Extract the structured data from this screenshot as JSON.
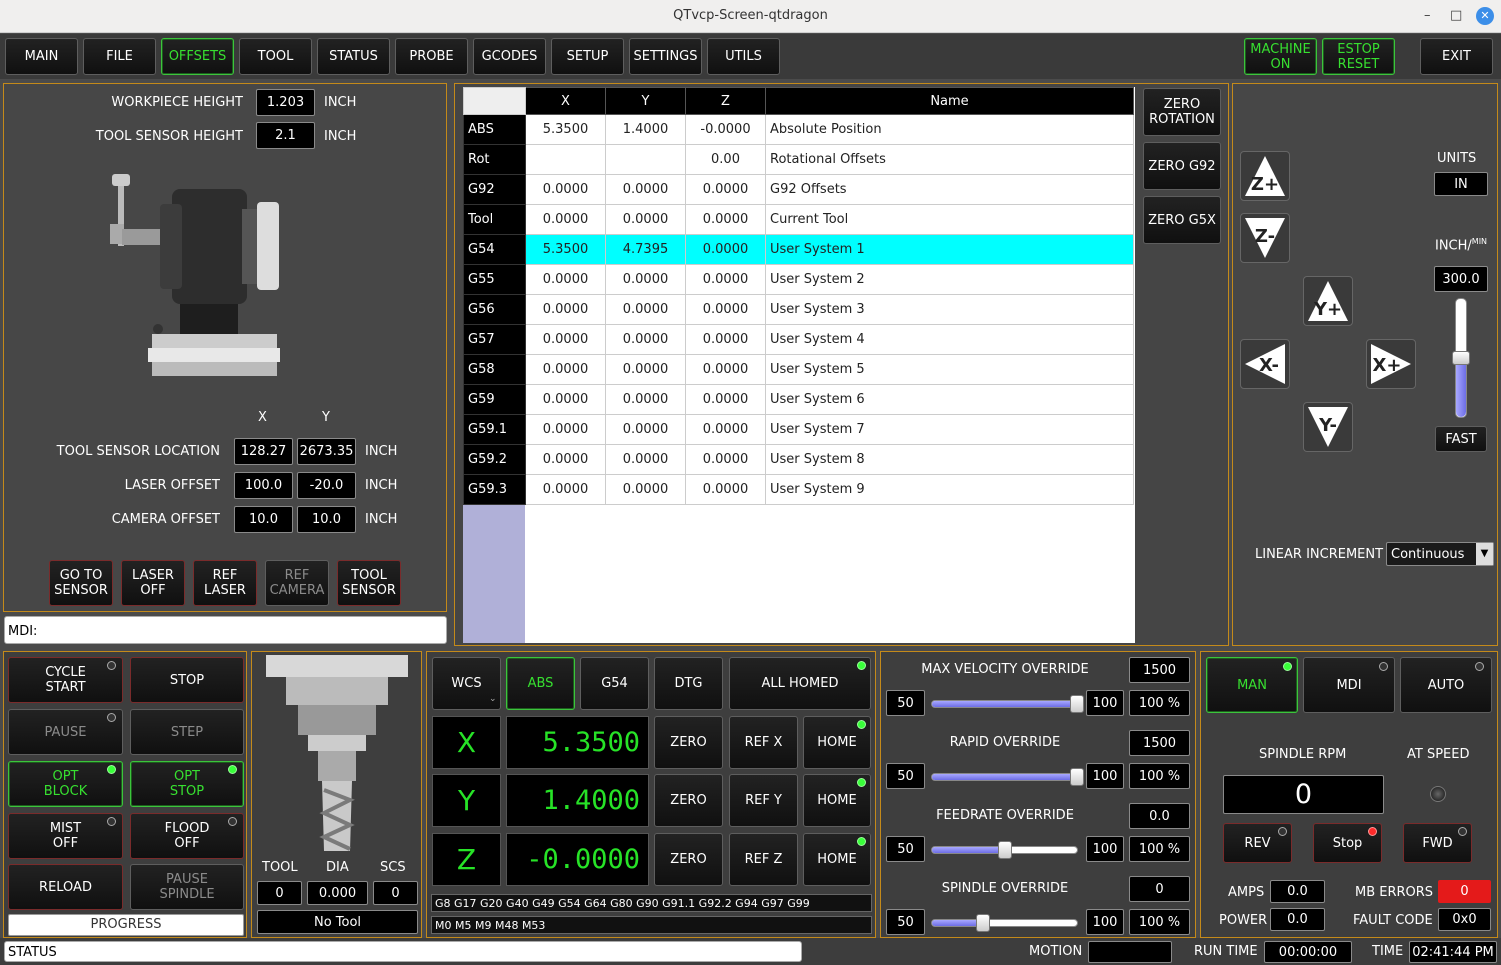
{
  "window": {
    "title": "QTvcp-Screen-qtdragon",
    "minimize": "–",
    "maximize": "□",
    "close": "✕"
  },
  "tabs": [
    {
      "label": "MAIN"
    },
    {
      "label": "FILE"
    },
    {
      "label": "OFFSETS"
    },
    {
      "label": "TOOL"
    },
    {
      "label": "STATUS"
    },
    {
      "label": "PROBE"
    },
    {
      "label": "GCODES"
    },
    {
      "label": "SETUP"
    },
    {
      "label": "SETTINGS"
    },
    {
      "label": "UTILS"
    }
  ],
  "machine": {
    "machine_on": "MACHINE\nON",
    "estop_reset": "ESTOP\nRESET",
    "exit": "EXIT"
  },
  "left": {
    "workpiece_height_label": "WORKPIECE HEIGHT",
    "workpiece_height": "1.203",
    "tool_sensor_height_label": "TOOL SENSOR HEIGHT",
    "tool_sensor_height": "2.1",
    "unit": "INCH",
    "col_x": "X",
    "col_y": "Y",
    "tool_sensor_location_label": "TOOL SENSOR LOCATION",
    "tsl_x": "128.27",
    "tsl_y": "2673.35",
    "laser_offset_label": "LASER OFFSET",
    "lo_x": "100.0",
    "lo_y": "-20.0",
    "camera_offset_label": "CAMERA OFFSET",
    "co_x": "10.0",
    "co_y": "10.0",
    "buttons": [
      {
        "label": "GO TO\nSENSOR"
      },
      {
        "label": "LASER\nOFF"
      },
      {
        "label": "REF\nLASER"
      },
      {
        "label": "REF\nCAMERA"
      },
      {
        "label": "TOOL\nSENSOR"
      }
    ]
  },
  "mdi": {
    "label": "MDI:"
  },
  "offsets_table": {
    "headers": [
      "",
      "X",
      "Y",
      "Z",
      "Name"
    ],
    "rows": [
      {
        "id": "ABS",
        "x": "5.3500",
        "y": "1.4000",
        "z": "-0.0000",
        "name": "Absolute Position"
      },
      {
        "id": "Rot",
        "x": "",
        "y": "",
        "z": "0.00",
        "name": "Rotational Offsets"
      },
      {
        "id": "G92",
        "x": "0.0000",
        "y": "0.0000",
        "z": "0.0000",
        "name": "G92 Offsets"
      },
      {
        "id": "Tool",
        "x": "0.0000",
        "y": "0.0000",
        "z": "0.0000",
        "name": "Current Tool"
      },
      {
        "id": "G54",
        "x": "5.3500",
        "y": "4.7395",
        "z": "0.0000",
        "name": "User System 1"
      },
      {
        "id": "G55",
        "x": "0.0000",
        "y": "0.0000",
        "z": "0.0000",
        "name": "User System 2"
      },
      {
        "id": "G56",
        "x": "0.0000",
        "y": "0.0000",
        "z": "0.0000",
        "name": "User System 3"
      },
      {
        "id": "G57",
        "x": "0.0000",
        "y": "0.0000",
        "z": "0.0000",
        "name": "User System 4"
      },
      {
        "id": "G58",
        "x": "0.0000",
        "y": "0.0000",
        "z": "0.0000",
        "name": "User System 5"
      },
      {
        "id": "G59",
        "x": "0.0000",
        "y": "0.0000",
        "z": "0.0000",
        "name": "User System 6"
      },
      {
        "id": "G59.1",
        "x": "0.0000",
        "y": "0.0000",
        "z": "0.0000",
        "name": "User System 7"
      },
      {
        "id": "G59.2",
        "x": "0.0000",
        "y": "0.0000",
        "z": "0.0000",
        "name": "User System 8"
      },
      {
        "id": "G59.3",
        "x": "0.0000",
        "y": "0.0000",
        "z": "0.0000",
        "name": "User System 9"
      }
    ],
    "zero_rotation": "ZERO\nROTATION",
    "zero_g92": "ZERO G92",
    "zero_g5x": "ZERO G5X"
  },
  "jog": {
    "units_label": "UNITS",
    "units": "IN",
    "rate_label": "INCH/",
    "rate_sup": "MIN",
    "rate": "300.0",
    "fast": "FAST",
    "linear_increment_label": "LINEAR INCREMENT",
    "linear_increment": "Continuous",
    "zplus": "Z+",
    "zminus": "Z-",
    "yplus": "Y+",
    "yminus": "Y-",
    "xplus": "X+",
    "xminus": "X-"
  },
  "cycle": {
    "cycle_start": "CYCLE\nSTART",
    "stop": "STOP",
    "pause": "PAUSE",
    "step": "STEP",
    "opt_block": "OPT\nBLOCK",
    "opt_stop": "OPT\nSTOP",
    "mist_off": "MIST\nOFF",
    "flood_off": "FLOOD\nOFF",
    "reload": "RELOAD",
    "pause_spindle": "PAUSE\nSPINDLE",
    "progress": "PROGRESS"
  },
  "tool": {
    "tool_label": "TOOL",
    "dia_label": "DIA",
    "scs_label": "SCS",
    "tool": "0",
    "dia": "0.000",
    "scs": "0",
    "name": "No Tool"
  },
  "dro": {
    "wcs": "WCS",
    "abs": "ABS",
    "g54": "G54",
    "dtg": "DTG",
    "all_homed": "ALL HOMED",
    "axes": [
      {
        "axis": "X",
        "value": "5.3500",
        "ref": "REF X"
      },
      {
        "axis": "Y",
        "value": "1.4000",
        "ref": "REF Y"
      },
      {
        "axis": "Z",
        "value": "-0.0000",
        "ref": "REF Z"
      }
    ],
    "zero": "ZERO",
    "home": "HOME",
    "gcodes": "G8 G17 G20 G40 G49 G54 G64 G80 G90 G91.1 G92.2 G94 G97 G99",
    "mcodes": "M0 M5 M9 M48 M53"
  },
  "overrides": [
    {
      "label": "MAX VELOCITY OVERRIDE",
      "value": "1500",
      "min": "50",
      "max": "100",
      "pct": "100 %",
      "level": 1.0
    },
    {
      "label": "RAPID OVERRIDE",
      "value": "1500",
      "min": "50",
      "max": "100",
      "pct": "100 %",
      "level": 1.0
    },
    {
      "label": "FEEDRATE OVERRIDE",
      "value": "0.0",
      "min": "50",
      "max": "100",
      "pct": "100 %",
      "level": 0.5
    },
    {
      "label": "SPINDLE OVERRIDE",
      "value": "0",
      "min": "50",
      "max": "100",
      "pct": "100 %",
      "level": 0.35
    }
  ],
  "modes": {
    "man": "MAN",
    "mdi": "MDI",
    "auto": "AUTO"
  },
  "spindle": {
    "rpm_label": "SPINDLE RPM",
    "rpm": "0",
    "at_speed_label": "AT SPEED",
    "rev": "REV",
    "stop": "Stop",
    "fwd": "FWD",
    "amps_label": "AMPS",
    "amps": "0.0",
    "mb_errors_label": "MB ERRORS",
    "mb_errors": "0",
    "power_label": "POWER",
    "power": "0.0",
    "fault_code_label": "FAULT CODE",
    "fault_code": "0x0"
  },
  "status": {
    "status": "STATUS",
    "motion_label": "MOTION",
    "motion": "",
    "run_time_label": "RUN TIME",
    "run_time": "00:00:00",
    "time_label": "TIME",
    "time": "02:41:44 PM"
  },
  "colors": {
    "panel_border": "#c48a1a",
    "active_green": "#37e030",
    "selected_row": "#00ffff"
  }
}
